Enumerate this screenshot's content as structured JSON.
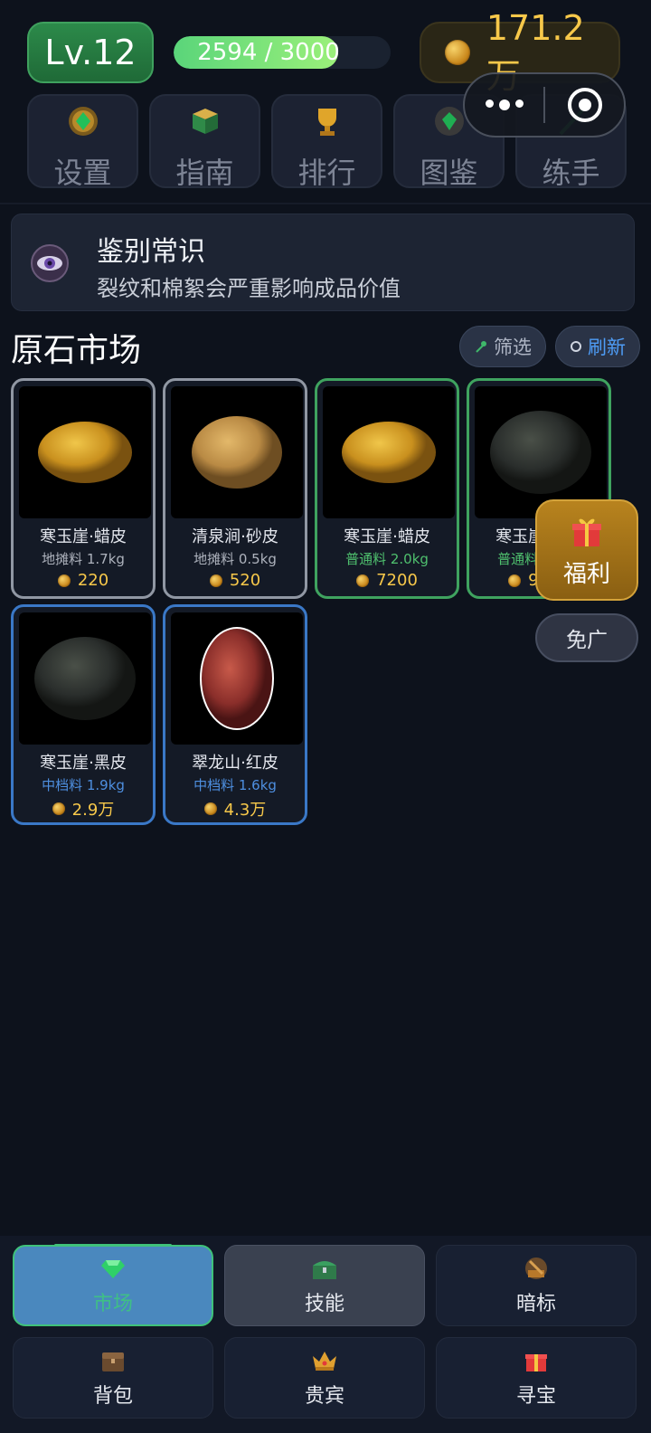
{
  "header": {
    "level": "Lv.12",
    "xp_text": "2594 / 3000",
    "xp_progress": 0.865,
    "coins": "171.2万"
  },
  "top_nav": [
    {
      "label": "设置",
      "icon": "emerald-gear-icon"
    },
    {
      "label": "指南",
      "icon": "book-icon"
    },
    {
      "label": "排行",
      "icon": "trophy-icon"
    },
    {
      "label": "图鉴",
      "icon": "gem-codex-icon"
    },
    {
      "label": "练手",
      "icon": "practice-icon"
    }
  ],
  "tip": {
    "title": "鉴别常识",
    "desc": "裂纹和棉絮会严重影响成品价值"
  },
  "market": {
    "title": "原石市场",
    "filter_label": "筛选",
    "refresh_label": "刷新"
  },
  "stones": [
    {
      "name": "寒玉崖·蜡皮",
      "grade": "地摊料 1.7kg",
      "price": "220",
      "tier": "gray",
      "stone": "yellow"
    },
    {
      "name": "清泉涧·砂皮",
      "grade": "地摊料 0.5kg",
      "price": "520",
      "tier": "gray",
      "stone": "sand"
    },
    {
      "name": "寒玉崖·蜡皮",
      "grade": "普通料 2.0kg",
      "price": "7200",
      "tier": "green",
      "stone": "yellow"
    },
    {
      "name": "寒玉崖·黑皮",
      "grade": "普通料 1.9kg",
      "price": "9000",
      "tier": "green",
      "stone": "black"
    },
    {
      "name": "寒玉崖·黑皮",
      "grade": "中档料 1.9kg",
      "price": "2.9万",
      "tier": "blue",
      "stone": "black"
    },
    {
      "name": "翠龙山·红皮",
      "grade": "中档料 1.6kg",
      "price": "4.3万",
      "tier": "blue",
      "stone": "red"
    }
  ],
  "floating": {
    "welfare_label": "福利",
    "noad_label": "免广"
  },
  "bottom_nav": [
    {
      "label": "市场",
      "icon": "gem-icon"
    },
    {
      "label": "技能",
      "icon": "chest-icon"
    },
    {
      "label": "暗标",
      "icon": "auction-icon"
    },
    {
      "label": "背包",
      "icon": "bag-chest-icon"
    },
    {
      "label": "贵宾",
      "icon": "crown-icon"
    },
    {
      "label": "寻宝",
      "icon": "gift-icon"
    }
  ],
  "colors": {
    "accent_green": "#3fc27a",
    "gold": "#f7c84a",
    "tier_green": "#3fa35f",
    "tier_blue": "#3a78c7",
    "tier_gray": "#9097a3"
  }
}
